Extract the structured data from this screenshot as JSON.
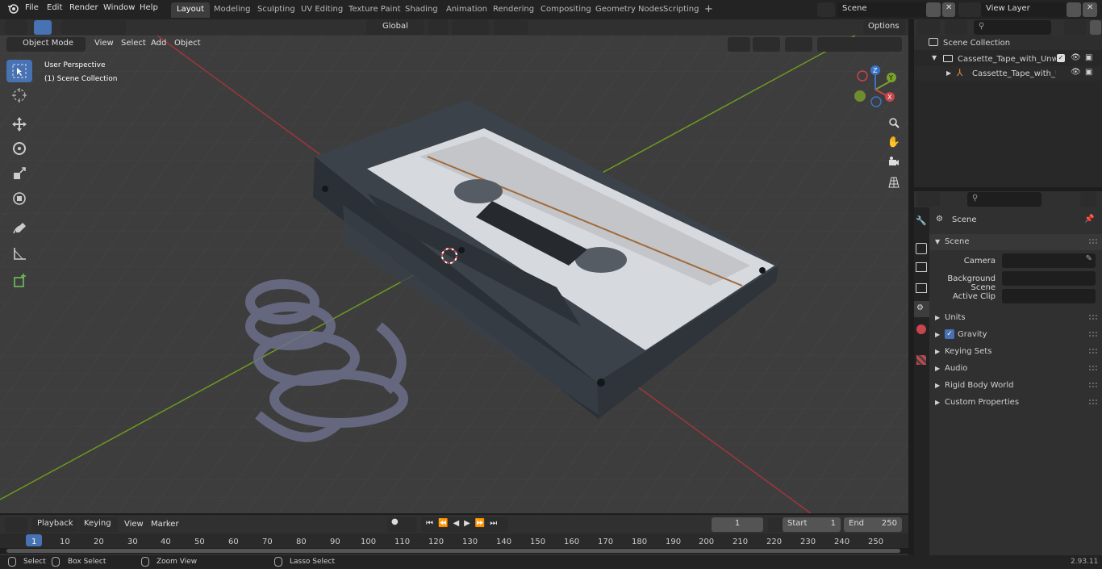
{
  "menu": [
    "File",
    "Edit",
    "Render",
    "Window",
    "Help"
  ],
  "workspaces": [
    "Layout",
    "Modeling",
    "Sculpting",
    "UV Editing",
    "Texture Paint",
    "Shading",
    "Animation",
    "Rendering",
    "Compositing",
    "Geometry Nodes",
    "Scripting"
  ],
  "scene_name": "Scene",
  "view_layer": "View Layer",
  "viewport": {
    "mode": "Object Mode",
    "menus": [
      "View",
      "Select",
      "Add",
      "Object"
    ],
    "transform_orientation": "Global",
    "options_label": "Options",
    "perspective_label": "User Perspective",
    "collection_label": "(1) Scene Collection"
  },
  "outliner": {
    "root": "Scene Collection",
    "collection": "Cassette_Tape_with_Unwoun",
    "object": "Cassette_Tape_with_Unw"
  },
  "properties": {
    "header": "Scene",
    "panel": "Scene",
    "camera_label": "Camera",
    "background_label": "Background Scene",
    "clip_label": "Active Clip",
    "sections": [
      "Units",
      "Gravity",
      "Keying Sets",
      "Audio",
      "Rigid Body World",
      "Custom Properties"
    ]
  },
  "timeline": {
    "menus": [
      "Playback",
      "Keying",
      "View",
      "Marker"
    ],
    "current_frame": "1",
    "start_label": "Start",
    "start_value": "1",
    "end_label": "End",
    "end_value": "250",
    "ticks": [
      "1",
      "10",
      "20",
      "30",
      "40",
      "50",
      "60",
      "70",
      "80",
      "90",
      "100",
      "110",
      "120",
      "130",
      "140",
      "150",
      "160",
      "170",
      "180",
      "190",
      "200",
      "210",
      "220",
      "230",
      "240",
      "250"
    ]
  },
  "status": {
    "select": "Select",
    "box_select": "Box Select",
    "zoom_view": "Zoom View",
    "lasso_select": "Lasso Select",
    "version": "2.93.11"
  },
  "axes": {
    "x": "X",
    "y": "Y",
    "z": "Z"
  },
  "colors": {
    "x_axis": "#c8444e",
    "y_axis": "#7aa12c",
    "z_axis": "#3a74c8",
    "accent": "#4772b3"
  }
}
